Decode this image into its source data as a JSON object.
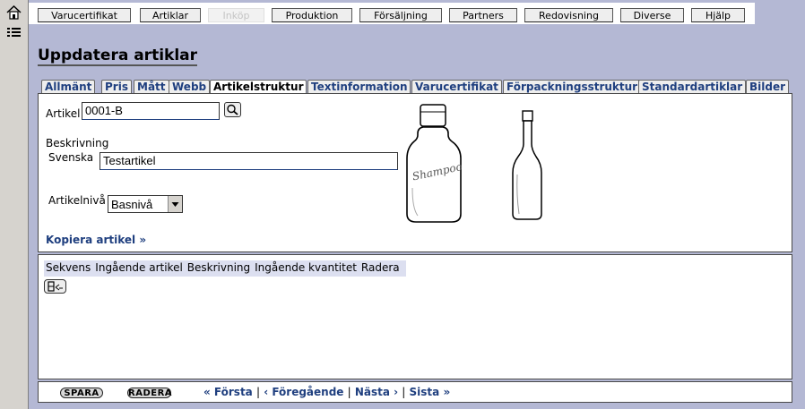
{
  "topnav": {
    "items": [
      "Varucertifikat",
      "Artiklar",
      "Inköp",
      "Produktion",
      "Försäljning",
      "Partners",
      "Redovisning",
      "Diverse",
      "Hjälp"
    ]
  },
  "page": {
    "title": "Uppdatera artiklar"
  },
  "tabs": [
    "Allmänt",
    "Pris",
    "Mått",
    "Webb",
    "Artikelstruktur",
    "Textinformation",
    "Varucertifikat",
    "Förpackningsstruktur",
    "Standardartiklar",
    "Bilder"
  ],
  "form": {
    "artikel_label": "Artikel",
    "artikel_value": "0001-B",
    "beskrivning_label": "Beskrivning",
    "svenska_label": "Svenska",
    "svenska_value": "Testartikel",
    "artikelniva_label": "Artikelnivå",
    "artikelniva_value": "Basnivå",
    "kopiera_link": "Kopiera artikel »"
  },
  "structure_table": {
    "columns": [
      "Sekvens",
      "Ingående artikel",
      "Beskrivning",
      "Ingående kvantitet",
      "Radera"
    ]
  },
  "footer": {
    "spara": "SPARA",
    "radera": "RADERA",
    "forsta": "« Första",
    "foregaende": "‹ Föregående",
    "nasta": "Nästa ›",
    "sista": "Sista »",
    "sep": "|"
  },
  "images": [
    {
      "label": "Shampoo",
      "icon": "shampoo-bottle-icon"
    },
    {
      "icon": "wine-bottle-icon"
    }
  ]
}
